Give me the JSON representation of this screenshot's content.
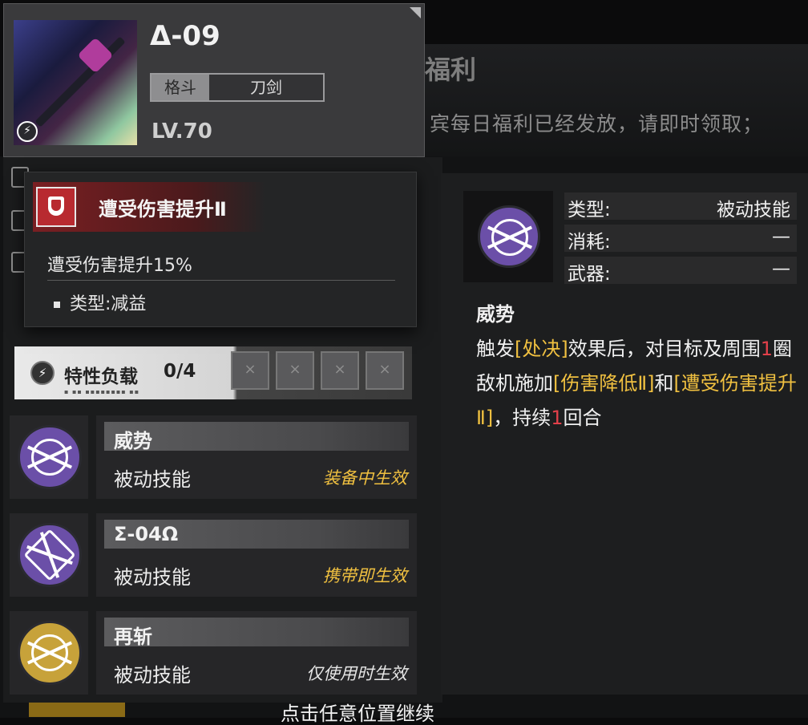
{
  "background": {
    "banner_title": "福利",
    "notice": "宾每日福利已经发放，请即时领取；"
  },
  "weapon": {
    "name": "Δ-09",
    "tag_category": "格斗",
    "tag_type": "刀剑",
    "level": "LV.70",
    "element_icon": "lightning-icon"
  },
  "tooltip": {
    "title": "遭受伤害提升Ⅱ",
    "description": "遭受伤害提升15%",
    "type": "类型:减益",
    "icon": "shield-icon"
  },
  "trait": {
    "label": "特性负载",
    "count": "0/4",
    "slots": 4
  },
  "skills": [
    {
      "name": "威势",
      "kind": "被动技能",
      "effect": "装备中生效",
      "effect_color": "#f0c040",
      "icon": "purple-orbit-icon"
    },
    {
      "name": "Σ-04Ω",
      "kind": "被动技能",
      "effect": "携带即生效",
      "effect_color": "#f0c040",
      "icon": "purple-blade-icon"
    },
    {
      "name": "再斩",
      "kind": "被动技能",
      "effect": "仅使用时生效",
      "effect_color": "#e6e6e6",
      "icon": "gold-chevron-icon"
    }
  ],
  "detail": {
    "attrs": [
      {
        "key": "类型:",
        "value": "被动技能"
      },
      {
        "key": "消耗:",
        "value": "—"
      },
      {
        "key": "武器:",
        "value": "—"
      }
    ],
    "name": "威势",
    "desc": {
      "p1": "触发",
      "t1": "[处决]",
      "p2": "效果后，对目标及周围",
      "n1": "1",
      "p3": "圈敌机施加",
      "t2": "[伤害降低Ⅱ]",
      "p4": "和",
      "t3": "[遭受伤害提升Ⅱ]",
      "p5": "，持续",
      "n2": "1",
      "p6": "回合"
    }
  },
  "footer": {
    "continue_hint": "点击任意位置继续"
  }
}
